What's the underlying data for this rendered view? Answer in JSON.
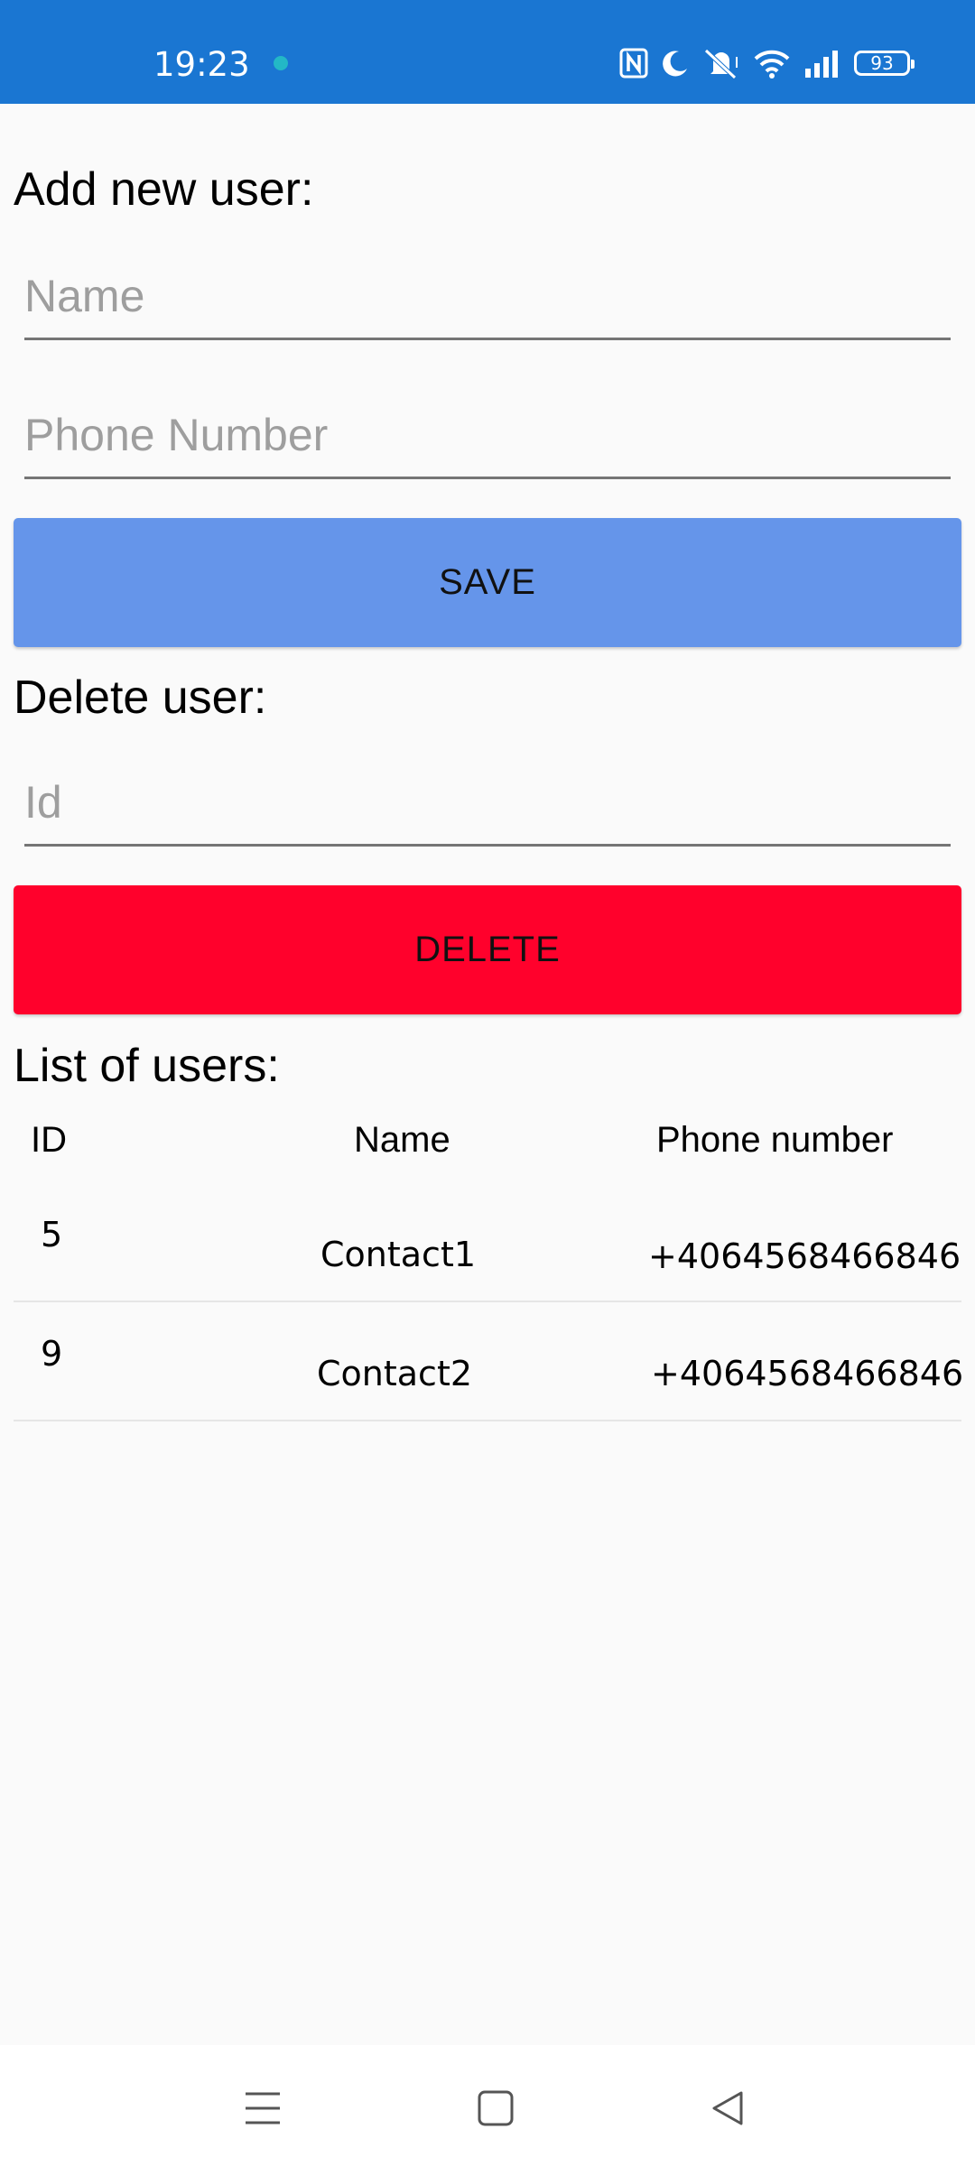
{
  "status_bar": {
    "time": "19:23",
    "battery": "93",
    "icons": [
      "notification-dot-icon",
      "nfc-icon",
      "moon-icon",
      "mute-icon",
      "wifi-icon",
      "signal-icon",
      "battery-icon"
    ]
  },
  "add_section": {
    "heading": "Add new user:",
    "name_placeholder": "Name",
    "phone_placeholder": "Phone Number",
    "save_label": "SAVE"
  },
  "delete_section": {
    "heading": "Delete user:",
    "id_placeholder": "Id",
    "delete_label": "DELETE"
  },
  "list_section": {
    "heading": "List of users:",
    "columns": [
      "ID",
      "Name",
      "Phone number"
    ],
    "rows": [
      {
        "id": "5",
        "name": "Contact1",
        "phone": "+4064568466846"
      },
      {
        "id": "9",
        "name": "Contact2",
        "phone": "+4064568466846"
      }
    ]
  },
  "nav_bar": {
    "icons": [
      "menu-icon",
      "home-icon",
      "back-icon"
    ]
  },
  "colors": {
    "status_bar": "#1a76d2",
    "save_button": "#6595ea",
    "delete_button": "#ff012c",
    "background": "#fafafa"
  }
}
